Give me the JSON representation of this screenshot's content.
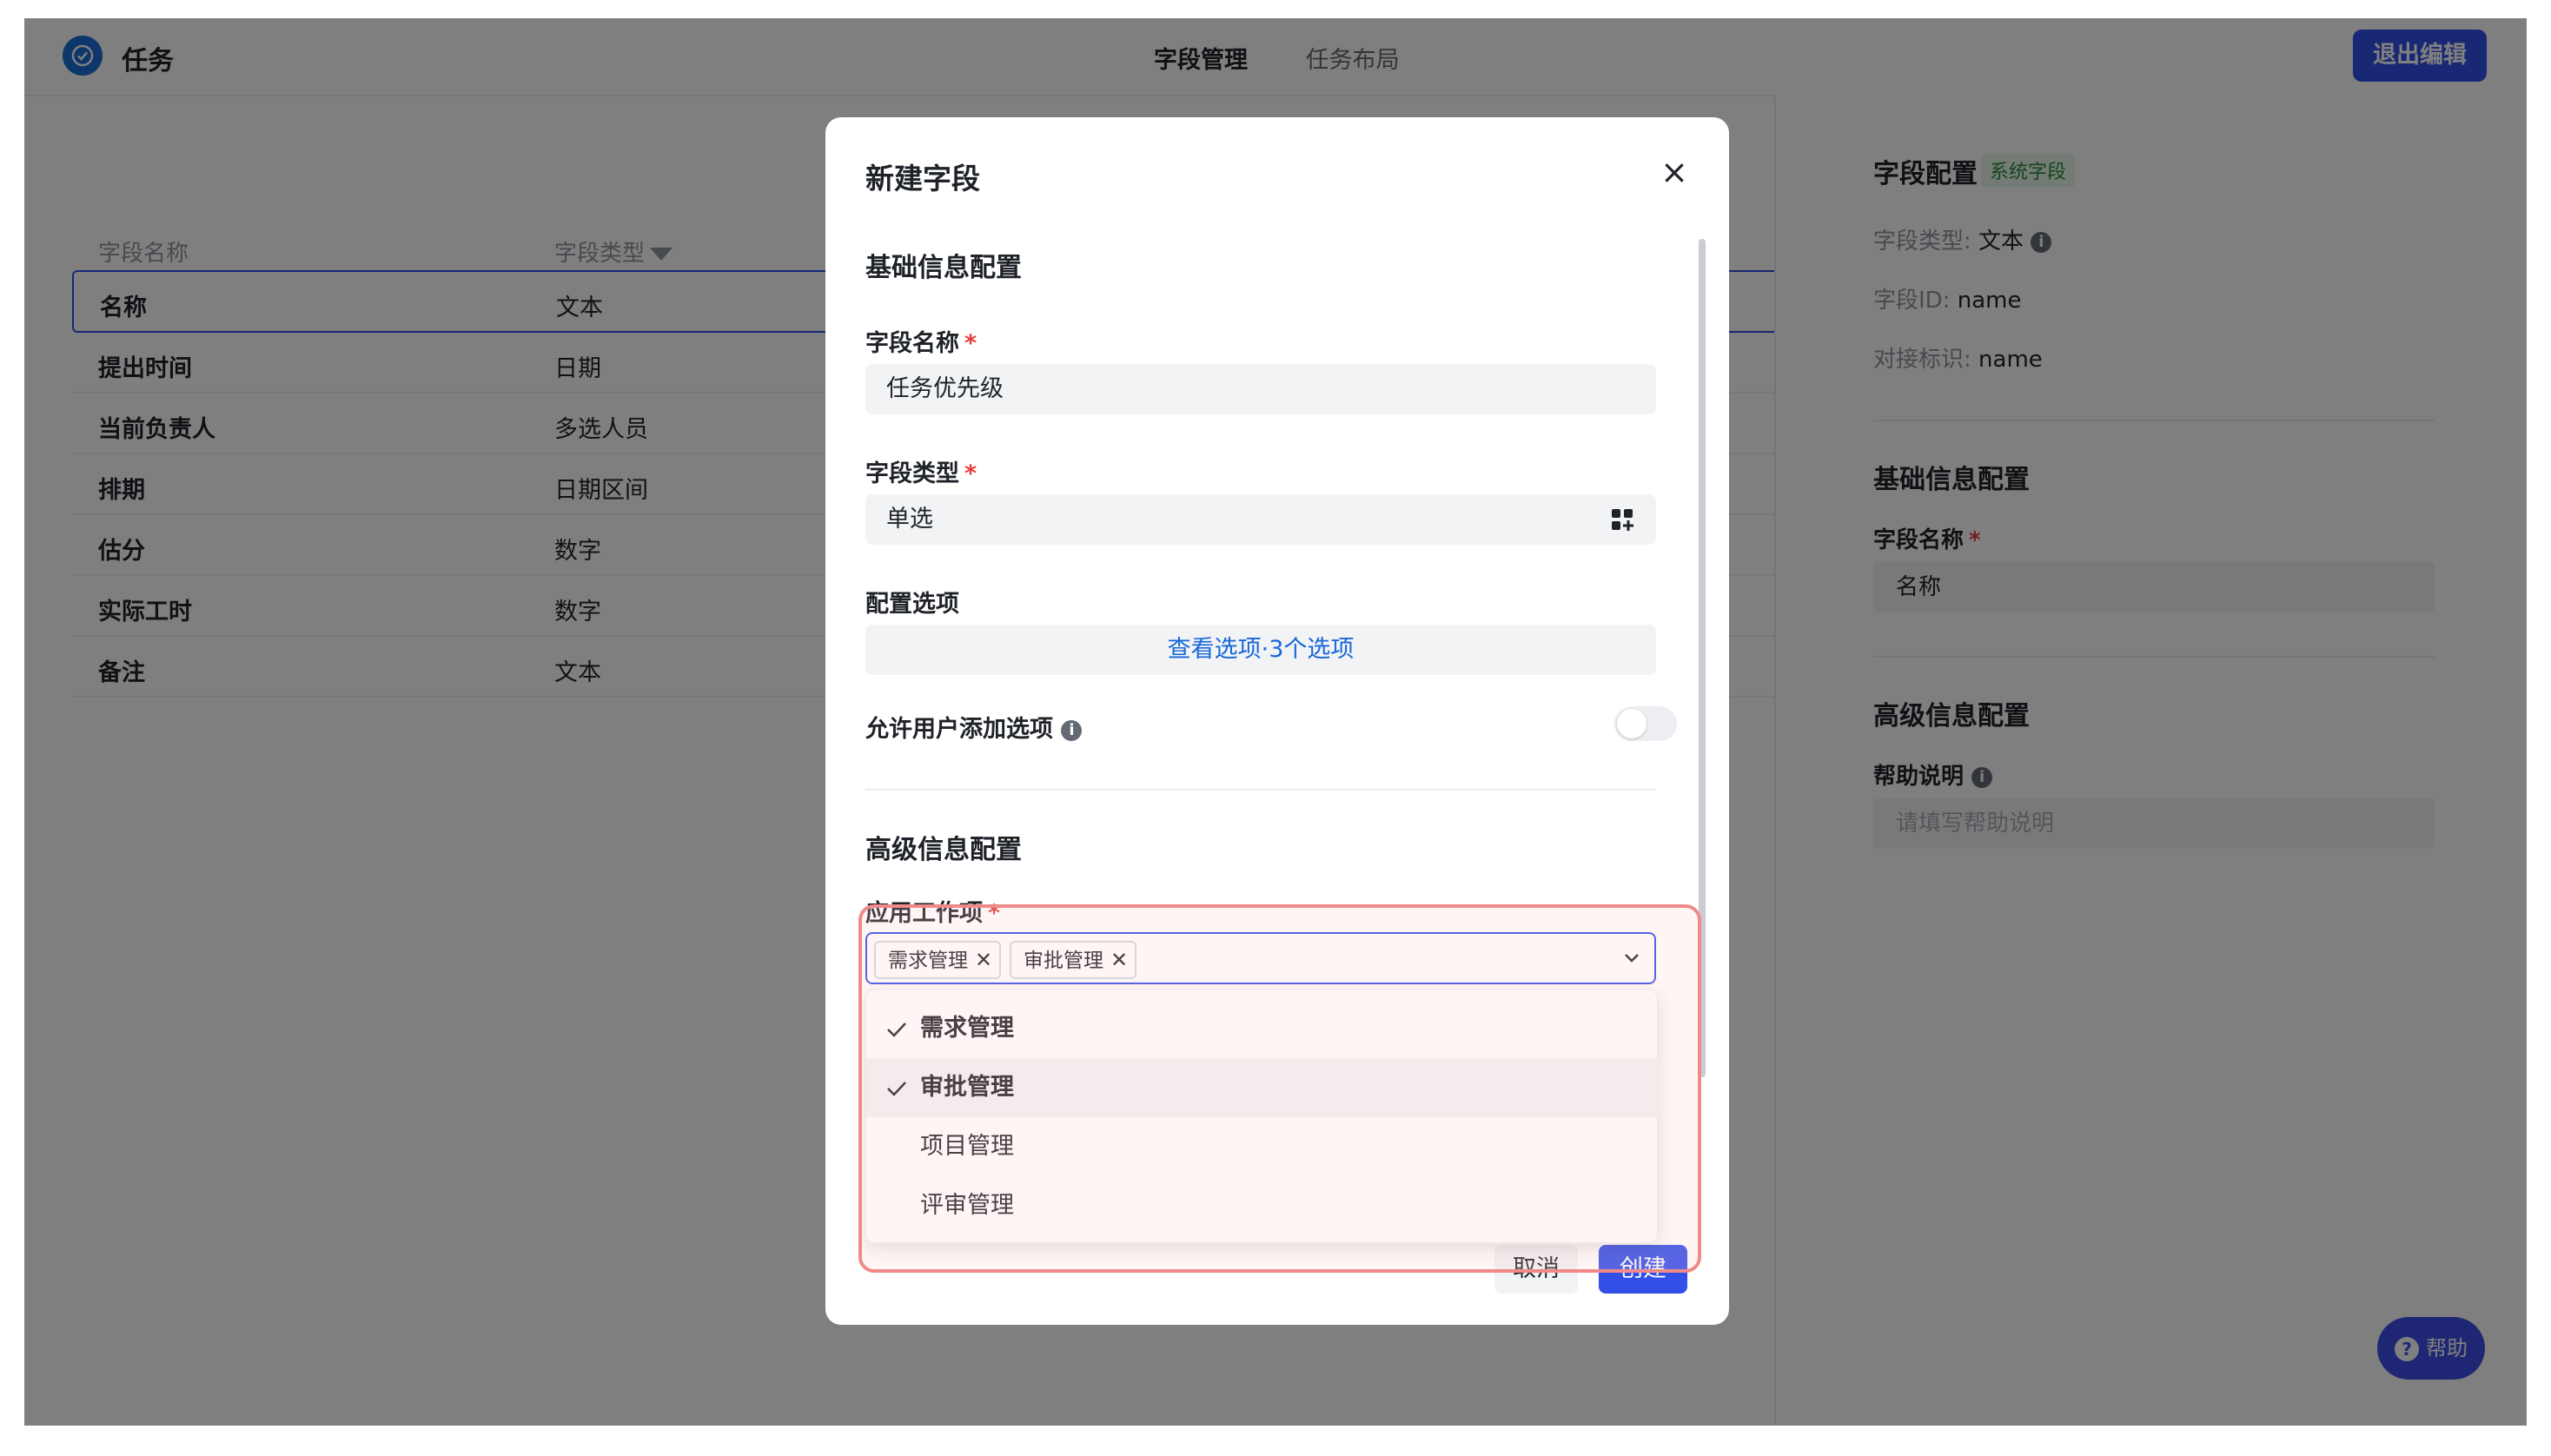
{
  "app": {
    "title": "任务"
  },
  "topnav": {
    "tabs": [
      {
        "label": "字段管理",
        "active": true
      },
      {
        "label": "任务布局",
        "active": false
      }
    ],
    "exit_label": "退出编辑"
  },
  "table": {
    "headers": {
      "name": "字段名称",
      "type": "字段类型"
    },
    "rows": [
      {
        "name": "名称",
        "type": "文本"
      },
      {
        "name": "提出时间",
        "type": "日期"
      },
      {
        "name": "当前负责人",
        "type": "多选人员"
      },
      {
        "name": "排期",
        "type": "日期区间"
      },
      {
        "name": "估分",
        "type": "数字"
      },
      {
        "name": "实际工时",
        "type": "数字"
      },
      {
        "name": "备注",
        "type": "文本"
      }
    ]
  },
  "right_panel": {
    "title": "字段配置",
    "tag": "系统字段",
    "field_type_label": "字段类型:",
    "field_type_value": "文本",
    "field_id_label": "字段ID:",
    "field_id_value": "name",
    "mapping_label": "对接标识:",
    "mapping_value": "name",
    "basic_section": "基础信息配置",
    "name_label": "字段名称",
    "name_value": "名称",
    "advanced_section": "高级信息配置",
    "help_label": "帮助说明",
    "help_placeholder": "请填写帮助说明"
  },
  "help_fab": {
    "label": "帮助"
  },
  "modal": {
    "title": "新建字段",
    "basic_section": "基础信息配置",
    "name_label": "字段名称",
    "name_value": "任务优先级",
    "type_label": "字段类型",
    "type_value": "单选",
    "options_label": "配置选项",
    "options_link": "查看选项·3个选项",
    "allow_add_label": "允许用户添加选项",
    "allow_add_enabled": false,
    "advanced_section": "高级信息配置",
    "apply_label": "应用工作项",
    "selected_chips": [
      "需求管理",
      "审批管理"
    ],
    "dropdown_options": [
      {
        "label": "需求管理",
        "checked": true
      },
      {
        "label": "审批管理",
        "checked": true
      },
      {
        "label": "项目管理",
        "checked": false
      },
      {
        "label": "评审管理",
        "checked": false
      }
    ],
    "cancel_label": "取消",
    "create_label": "创建"
  },
  "colors": {
    "accent": "#3250e8",
    "link": "#1667d9",
    "required": "#e63a3a",
    "highlight": "#f08a8a"
  }
}
